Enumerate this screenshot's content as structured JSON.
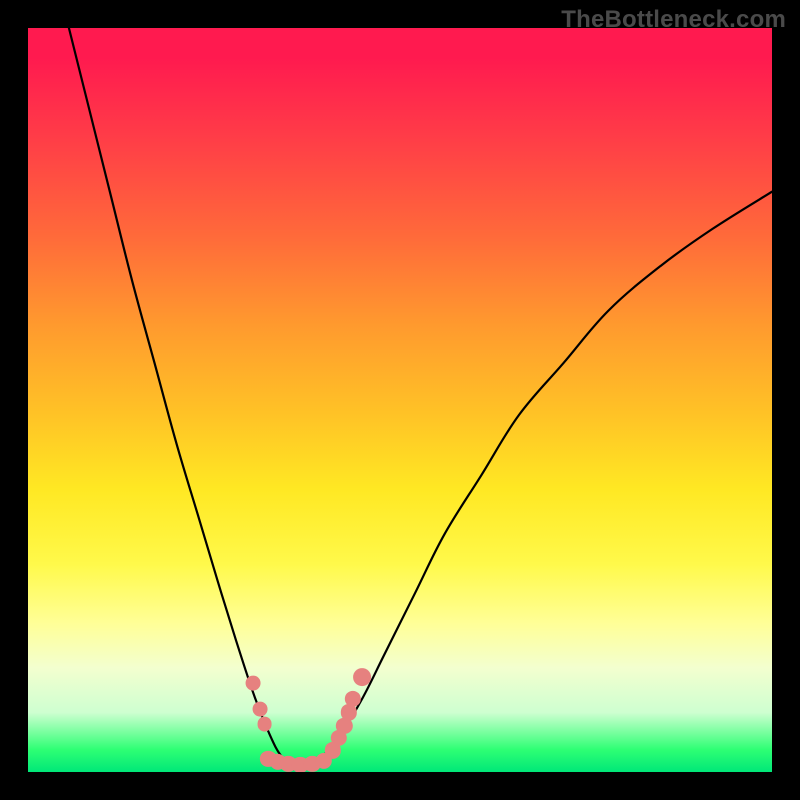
{
  "watermark": "TheBottleneck.com",
  "colors": {
    "curve_stroke": "#000000",
    "marker_fill": "#e6817f",
    "frame_bg": "#000000"
  },
  "chart_data": {
    "type": "line",
    "title": "",
    "xlabel": "",
    "ylabel": "",
    "xlim": [
      0,
      100
    ],
    "ylim": [
      0,
      100
    ],
    "curve": [
      {
        "x": 5.5,
        "y": 100
      },
      {
        "x": 8,
        "y": 90
      },
      {
        "x": 11,
        "y": 78
      },
      {
        "x": 14,
        "y": 66
      },
      {
        "x": 17,
        "y": 55
      },
      {
        "x": 20,
        "y": 44
      },
      {
        "x": 23,
        "y": 34
      },
      {
        "x": 26,
        "y": 24
      },
      {
        "x": 28.5,
        "y": 16
      },
      {
        "x": 30.5,
        "y": 10
      },
      {
        "x": 32.5,
        "y": 5
      },
      {
        "x": 34,
        "y": 2.2
      },
      {
        "x": 35.5,
        "y": 1.2
      },
      {
        "x": 37,
        "y": 1
      },
      {
        "x": 38.5,
        "y": 1.4
      },
      {
        "x": 40,
        "y": 2.5
      },
      {
        "x": 42,
        "y": 5
      },
      {
        "x": 45,
        "y": 10
      },
      {
        "x": 48,
        "y": 16
      },
      {
        "x": 52,
        "y": 24
      },
      {
        "x": 56,
        "y": 32
      },
      {
        "x": 61,
        "y": 40
      },
      {
        "x": 66,
        "y": 48
      },
      {
        "x": 72,
        "y": 55
      },
      {
        "x": 78,
        "y": 62
      },
      {
        "x": 85,
        "y": 68
      },
      {
        "x": 92,
        "y": 73
      },
      {
        "x": 100,
        "y": 78
      }
    ],
    "markers": [
      {
        "x": 30.2,
        "y": 12.0,
        "r": 1.0
      },
      {
        "x": 31.2,
        "y": 8.5,
        "r": 1.0
      },
      {
        "x": 31.8,
        "y": 6.5,
        "r": 1.0
      },
      {
        "x": 32.3,
        "y": 1.8,
        "r": 1.1
      },
      {
        "x": 33.6,
        "y": 1.4,
        "r": 1.1
      },
      {
        "x": 35.0,
        "y": 1.1,
        "r": 1.1
      },
      {
        "x": 36.6,
        "y": 1.0,
        "r": 1.1
      },
      {
        "x": 38.2,
        "y": 1.1,
        "r": 1.1
      },
      {
        "x": 39.8,
        "y": 1.5,
        "r": 1.1
      },
      {
        "x": 41.0,
        "y": 2.9,
        "r": 1.1
      },
      {
        "x": 41.8,
        "y": 4.6,
        "r": 1.1
      },
      {
        "x": 42.5,
        "y": 6.2,
        "r": 1.1
      },
      {
        "x": 43.1,
        "y": 8.0,
        "r": 1.1
      },
      {
        "x": 43.7,
        "y": 9.8,
        "r": 1.1
      },
      {
        "x": 44.9,
        "y": 12.8,
        "r": 1.2
      }
    ]
  }
}
